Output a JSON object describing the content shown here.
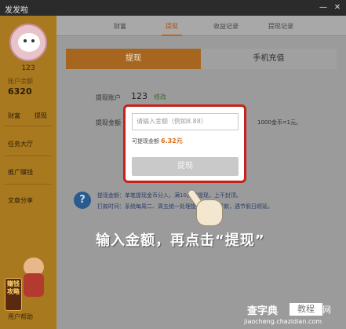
{
  "window": {
    "title": "发发啦",
    "controls": [
      "—",
      "✕"
    ]
  },
  "sidebar": {
    "username": "123",
    "account_label": "账户余额",
    "account_value": "6320",
    "links": [
      "财富",
      "提现"
    ],
    "menu": [
      "任务大厅",
      "推广赚钱",
      "文章分享"
    ],
    "badge_text": "赚钱攻略",
    "user_help": "用户帮助"
  },
  "tabs": [
    "财富",
    "提现",
    "收益记录",
    "提现记录"
  ],
  "active_tab": "提现",
  "subtabs": {
    "active": "提现",
    "other": "手机充值"
  },
  "form": {
    "account_label": "提现账户",
    "account_value": "123",
    "modify_label": "修改",
    "amount_label": "提现金额",
    "rate_text": "1000金币=1元。"
  },
  "modal": {
    "input_placeholder": "请输入金额（例如8.88）",
    "available_label": "可提现金额",
    "available_value": "6.32元",
    "button_label": "提现"
  },
  "info": {
    "icon": "?",
    "line1": "提现金额：单笔提现金币分入，满10元起提现，上不封顶。",
    "line2": "打款时间：系统每周二、周五统一处理提现申请并打款，遇节假日顺延。"
  },
  "caption": "输入金额，再点击“提现”",
  "watermark": {
    "site": "查字典",
    "label1": "教程",
    "label2": "网",
    "url": "jiaocheng.chazidian.com"
  }
}
